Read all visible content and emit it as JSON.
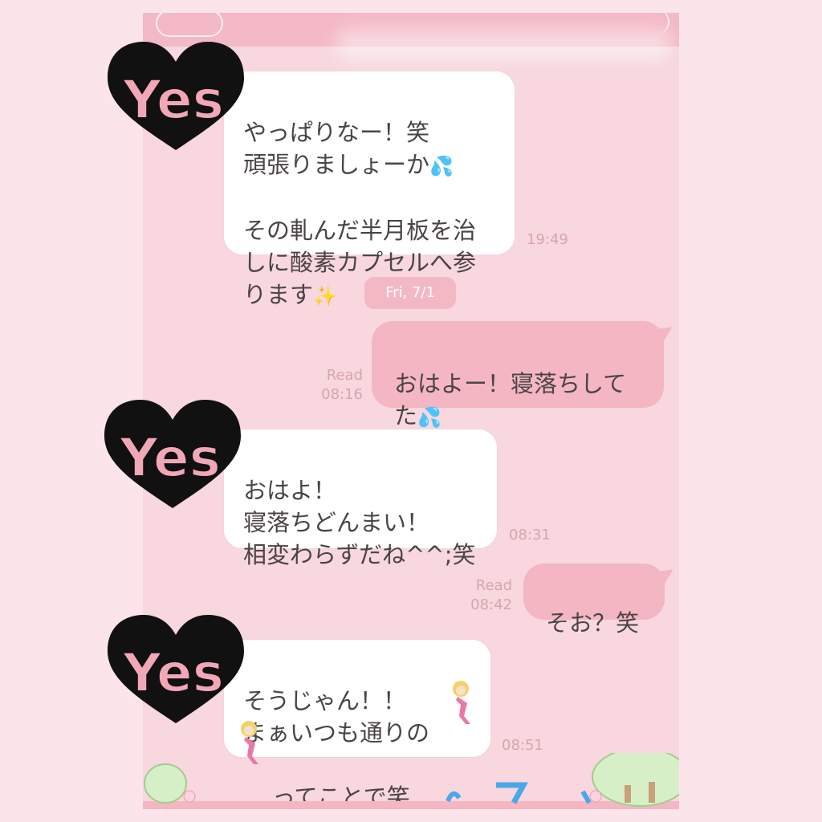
{
  "messages": [
    {
      "text": "やっぱりなー！笑\n頑張りましょーか",
      "tail_icon": "sweat-droplets",
      "text2": "その軋んだ半月板を治\nしに酸素カプセルへ参\nります",
      "tail_icon2": "sparkles",
      "time": "19:49"
    },
    {
      "text": "おはよー！寝落ちして\nた",
      "tail_icon": "sweat-droplets",
      "read": "Read",
      "time": "08:16"
    },
    {
      "text": "おはよ！\n寝落ちどんまい！\n相変わらずだね^^;笑",
      "time": "08:31"
    },
    {
      "text": "そお？笑",
      "read": "Read",
      "time": "08:42"
    },
    {
      "text": "そうじゃん！！\nまぁいつも通りの",
      "text2": "ってことで笑",
      "time": "08:51"
    }
  ],
  "date_separator": "Fri, 7/1",
  "avatar_text": "Yes",
  "icons": {
    "avatar": "yes-heart-sticker-icon",
    "droplets": "sweat-droplets-icon",
    "sparkles": "sparkles-icon",
    "figure": "blonde-figure-icon"
  },
  "colors": {
    "background": "#f8d7de",
    "outgoing_bubble": "#f4b6c3",
    "incoming_bubble": "#ffffff",
    "timestamp": "#d7a5ae",
    "avatar_heart": "#111111",
    "avatar_letters": "#f2a7b7"
  }
}
